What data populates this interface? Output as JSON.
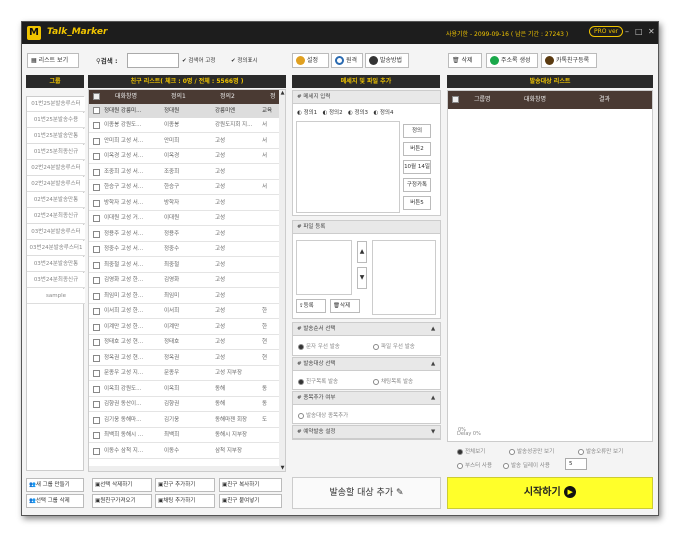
{
  "app": {
    "logo": "M",
    "title": "Talk_Marker",
    "license": "사용기한 - 2099-09-16 ( 남은 기간 : 27243 )",
    "version": "PRO ver",
    "minimize": "–",
    "maximize": "□",
    "close": "✕"
  },
  "toolbar": {
    "list_view": "리스트 보기",
    "search_label": "검색 :",
    "search_value": "",
    "search_fixed": "검색어 고정",
    "show_def": "정의표시",
    "settings": "설정",
    "prev": "원격",
    "send_method": "발송방법",
    "delete": "삭제",
    "friend_add": "주소록 생성",
    "kakao_friends": "카톡친구등록"
  },
  "groups": {
    "header": "그룹",
    "items": [
      "01번25분발송루스터",
      "01번25분발송수용",
      "01번25분발송만통",
      "01번25분최종신규",
      "02번24분발송루스터",
      "02번24분발송루스터",
      "02번24분발송만통",
      "02번24분최종신규",
      "03번24분발송루스터",
      "03번24분발송루스터1",
      "03번24분발송만통",
      "03번24분최종신규",
      "sample"
    ]
  },
  "friends": {
    "header": "친구 리스트( 체크 : 0명 / 전체 : 5566명 )",
    "cols": [
      "대화창명",
      "정의1",
      "정의2",
      "정"
    ],
    "sub": [
      "정대원 강릉미...",
      "정대원",
      "강릉미엔",
      "교육"
    ],
    "rows": [
      [
        "이종봉 강원도...",
        "이종봉",
        "강원도지회 지...",
        "서"
      ],
      [
        "안미희 고성 서...",
        "안미희",
        "고성",
        "서"
      ],
      [
        "이옥경 고성 서...",
        "이옥경",
        "고성",
        "서"
      ],
      [
        "조중희 고성 서...",
        "조중희",
        "고성",
        ""
      ],
      [
        "한승구 고성 서...",
        "한승구",
        "고성",
        "서"
      ],
      [
        "방학자 고성 서...",
        "방학자",
        "고성",
        ""
      ],
      [
        "이대원 고성 거...",
        "이대원",
        "고성",
        ""
      ],
      [
        "정용주 고성 서...",
        "정용주",
        "고성",
        ""
      ],
      [
        "정중수 고성 서...",
        "정중수",
        "고성",
        ""
      ],
      [
        "최중철 고성 서...",
        "최중철",
        "고성",
        ""
      ],
      [
        "김영화 고성 한...",
        "김영화",
        "고성",
        ""
      ],
      [
        "최임미 고성 한...",
        "최임미",
        "고성",
        ""
      ],
      [
        "이서희 고성 한...",
        "이서희",
        "고성",
        "한"
      ],
      [
        "이계만 고성 한...",
        "이계만",
        "고성",
        "한"
      ],
      [
        "정태호 고성 현...",
        "정태호",
        "고성",
        "현"
      ],
      [
        "정옥권 고성 현...",
        "정옥권",
        "고성",
        "현"
      ],
      [
        "문종우 고성 지...",
        "문종우",
        "고성 지부장",
        ""
      ],
      [
        "이옥희 강원도...",
        "이옥희",
        "동해",
        "동"
      ],
      [
        "김향권 동산이...",
        "김향권",
        "동해",
        "동"
      ],
      [
        "김기웅 동해마...",
        "김기웅",
        "동해마젠 회장",
        "도"
      ],
      [
        "최백희 동해시 ...",
        "최백희",
        "동해시 지부장",
        ""
      ],
      [
        "이동수 삼척 지...",
        "이동수",
        "삼척 지부장",
        ""
      ]
    ]
  },
  "message": {
    "header": "메세지 및 파일 추가",
    "input_title": "# 메세지 입력",
    "tabs": [
      "정의1",
      "정의2",
      "정의3",
      "정의4"
    ],
    "side_buttons": [
      "정의",
      "버튼2",
      "10월 14일",
      "구정카톡",
      "버튼5"
    ],
    "file_title": "# 파일 등록",
    "up": "▲",
    "down": "▼",
    "reg": "등록",
    "del": "삭제",
    "order_title": "# 발송순서 선택",
    "order_opts": [
      "문자 우선 발송",
      "파일 우선 발송"
    ],
    "target_title": "# 발송대상 선택",
    "target_opts": [
      "친구목록 발송",
      "채팅목록 발송"
    ],
    "friend_add_title": "# 종목추가 여부",
    "friend_add_opt": "발송대상 종목추가",
    "schedule_title": "# 예약발송 설정"
  },
  "targets": {
    "header": "발송대상 리스트",
    "cols": [
      "그룹명",
      "대화창명",
      "결과"
    ],
    "progress": "0%",
    "delay": "Delay 0%",
    "view_opts": [
      "전체보기",
      "발송성공만 보기",
      "발송오류만 보기"
    ],
    "bustr": "부스터 사용",
    "delay_use": "발송 딜레이 사용",
    "delay_val": "5"
  },
  "bottom": {
    "new_group": "새 그룹 만들기",
    "del_group": "선택 그룹 삭제",
    "del_sel": "선택 삭제하기",
    "copy_friends": "원친구가져오기",
    "add_friend": "친구 추가하기",
    "add_chat": "채팅 추가하기",
    "copy_friend": "친구 복사하기",
    "paste_friend": "친구 붙여넣기",
    "add_target": "발송할 대상 추가",
    "start": "시작하기"
  }
}
